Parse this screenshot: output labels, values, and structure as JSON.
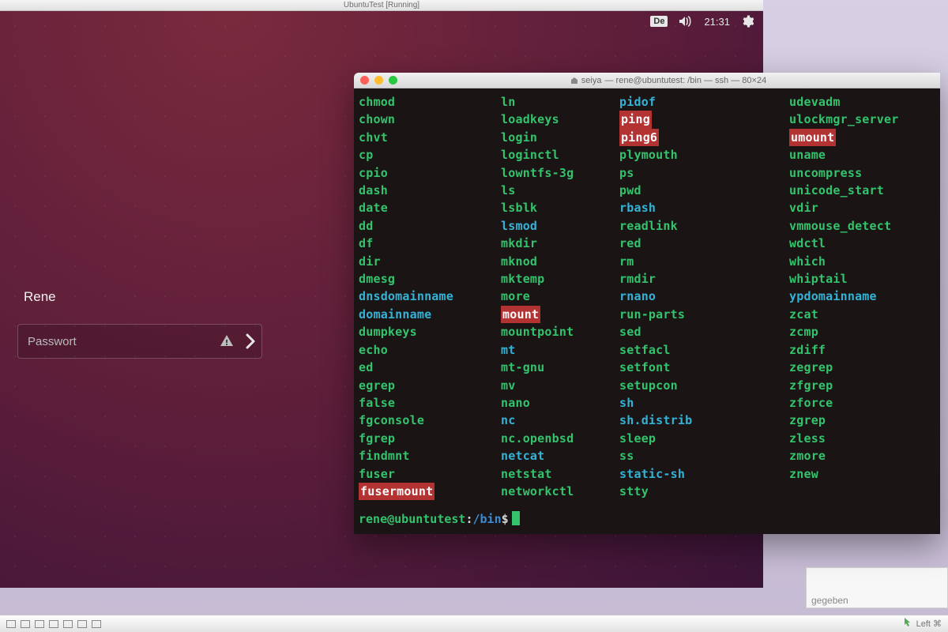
{
  "vm": {
    "title": "UbuntuTest [Running]"
  },
  "topbar": {
    "keyboard": "De",
    "time": "21:31"
  },
  "login": {
    "username": "Rene",
    "password_placeholder": "Passwort"
  },
  "terminal": {
    "title_left": "seiya",
    "title_rest": "— rene@ubuntutest: /bin — ssh — 80×24",
    "prompt": {
      "user": "rene",
      "host": "ubuntutest",
      "path": "/bin",
      "symbol": "$"
    },
    "columns": [
      [
        {
          "t": "chmod",
          "c": "g"
        },
        {
          "t": "chown",
          "c": "g"
        },
        {
          "t": "chvt",
          "c": "g"
        },
        {
          "t": "cp",
          "c": "g"
        },
        {
          "t": "cpio",
          "c": "g"
        },
        {
          "t": "dash",
          "c": "g"
        },
        {
          "t": "date",
          "c": "g"
        },
        {
          "t": "dd",
          "c": "g"
        },
        {
          "t": "df",
          "c": "g"
        },
        {
          "t": "dir",
          "c": "g"
        },
        {
          "t": "dmesg",
          "c": "g"
        },
        {
          "t": "dnsdomainname",
          "c": "b"
        },
        {
          "t": "domainname",
          "c": "b"
        },
        {
          "t": "dumpkeys",
          "c": "g"
        },
        {
          "t": "echo",
          "c": "g"
        },
        {
          "t": "ed",
          "c": "g"
        },
        {
          "t": "egrep",
          "c": "g"
        },
        {
          "t": "false",
          "c": "g"
        },
        {
          "t": "fgconsole",
          "c": "g"
        },
        {
          "t": "fgrep",
          "c": "g"
        },
        {
          "t": "findmnt",
          "c": "g"
        },
        {
          "t": "fuser",
          "c": "g"
        },
        {
          "t": "fusermount",
          "c": "hl"
        }
      ],
      [
        {
          "t": "ln",
          "c": "g"
        },
        {
          "t": "loadkeys",
          "c": "g"
        },
        {
          "t": "login",
          "c": "g"
        },
        {
          "t": "loginctl",
          "c": "g"
        },
        {
          "t": "lowntfs-3g",
          "c": "g"
        },
        {
          "t": "ls",
          "c": "g"
        },
        {
          "t": "lsblk",
          "c": "g"
        },
        {
          "t": "lsmod",
          "c": "b"
        },
        {
          "t": "mkdir",
          "c": "g"
        },
        {
          "t": "mknod",
          "c": "g"
        },
        {
          "t": "mktemp",
          "c": "g"
        },
        {
          "t": "more",
          "c": "g"
        },
        {
          "t": "mount",
          "c": "hl"
        },
        {
          "t": "mountpoint",
          "c": "g"
        },
        {
          "t": "mt",
          "c": "b"
        },
        {
          "t": "mt-gnu",
          "c": "g"
        },
        {
          "t": "mv",
          "c": "g"
        },
        {
          "t": "nano",
          "c": "g"
        },
        {
          "t": "nc",
          "c": "b"
        },
        {
          "t": "nc.openbsd",
          "c": "g"
        },
        {
          "t": "netcat",
          "c": "b"
        },
        {
          "t": "netstat",
          "c": "g"
        },
        {
          "t": "networkctl",
          "c": "g"
        }
      ],
      [
        {
          "t": "pidof",
          "c": "b"
        },
        {
          "t": "ping",
          "c": "hl"
        },
        {
          "t": "ping6",
          "c": "hl"
        },
        {
          "t": "plymouth",
          "c": "g"
        },
        {
          "t": "ps",
          "c": "g"
        },
        {
          "t": "pwd",
          "c": "g"
        },
        {
          "t": "rbash",
          "c": "b"
        },
        {
          "t": "readlink",
          "c": "g"
        },
        {
          "t": "red",
          "c": "g"
        },
        {
          "t": "rm",
          "c": "g"
        },
        {
          "t": "rmdir",
          "c": "g"
        },
        {
          "t": "rnano",
          "c": "b"
        },
        {
          "t": "run-parts",
          "c": "g"
        },
        {
          "t": "sed",
          "c": "g"
        },
        {
          "t": "setfacl",
          "c": "g"
        },
        {
          "t": "setfont",
          "c": "g"
        },
        {
          "t": "setupcon",
          "c": "g"
        },
        {
          "t": "sh",
          "c": "b"
        },
        {
          "t": "sh.distrib",
          "c": "b"
        },
        {
          "t": "sleep",
          "c": "g"
        },
        {
          "t": "ss",
          "c": "g"
        },
        {
          "t": "static-sh",
          "c": "b"
        },
        {
          "t": "stty",
          "c": "g"
        }
      ],
      [
        {
          "t": "udevadm",
          "c": "g"
        },
        {
          "t": "ulockmgr_server",
          "c": "g"
        },
        {
          "t": "umount",
          "c": "hl"
        },
        {
          "t": "uname",
          "c": "g"
        },
        {
          "t": "uncompress",
          "c": "g"
        },
        {
          "t": "unicode_start",
          "c": "g"
        },
        {
          "t": "vdir",
          "c": "g"
        },
        {
          "t": "vmmouse_detect",
          "c": "g"
        },
        {
          "t": "wdctl",
          "c": "g"
        },
        {
          "t": "which",
          "c": "g"
        },
        {
          "t": "whiptail",
          "c": "g"
        },
        {
          "t": "ypdomainname",
          "c": "b"
        },
        {
          "t": "zcat",
          "c": "g"
        },
        {
          "t": "zcmp",
          "c": "g"
        },
        {
          "t": "zdiff",
          "c": "g"
        },
        {
          "t": "zegrep",
          "c": "g"
        },
        {
          "t": "zfgrep",
          "c": "g"
        },
        {
          "t": "zforce",
          "c": "g"
        },
        {
          "t": "zgrep",
          "c": "g"
        },
        {
          "t": "zless",
          "c": "g"
        },
        {
          "t": "zmore",
          "c": "g"
        },
        {
          "t": "znew",
          "c": "g"
        }
      ]
    ]
  },
  "snippet": {
    "text": "gegeben"
  },
  "statusbar": {
    "hostkey": "Left ⌘"
  }
}
